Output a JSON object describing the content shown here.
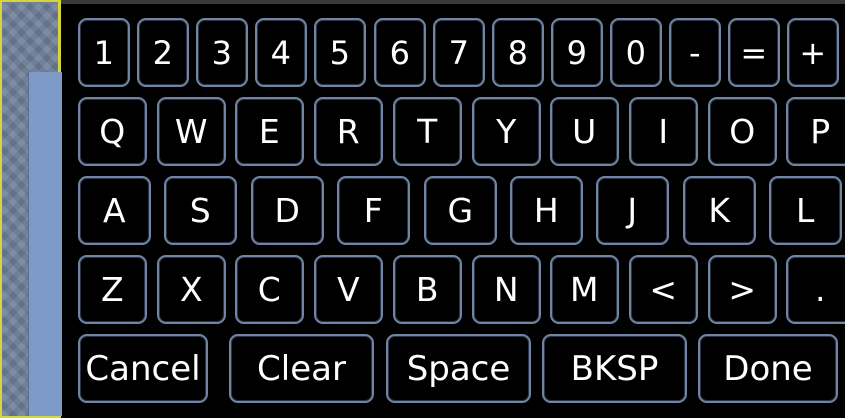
{
  "keyboard": {
    "number_row": [
      "1",
      "2",
      "3",
      "4",
      "5",
      "6",
      "7",
      "8",
      "9",
      "0",
      "-",
      "=",
      "+"
    ],
    "row_qwerty": [
      "Q",
      "W",
      "E",
      "R",
      "T",
      "Y",
      "U",
      "I",
      "O",
      "P"
    ],
    "row_asdf": [
      "A",
      "S",
      "D",
      "F",
      "G",
      "H",
      "J",
      "K",
      "L"
    ],
    "row_zxcv": [
      "Z",
      "X",
      "C",
      "V",
      "B",
      "N",
      "M",
      "<",
      ">",
      "."
    ],
    "actions": {
      "cancel": "Cancel",
      "clear": "Clear",
      "space": "Space",
      "backspace": "BKSP",
      "done": "Done"
    }
  },
  "colors": {
    "key_border": "#6f85a3",
    "background": "#000000",
    "panel_border": "#d6d63a",
    "panel_fill": "#7d99c6"
  }
}
